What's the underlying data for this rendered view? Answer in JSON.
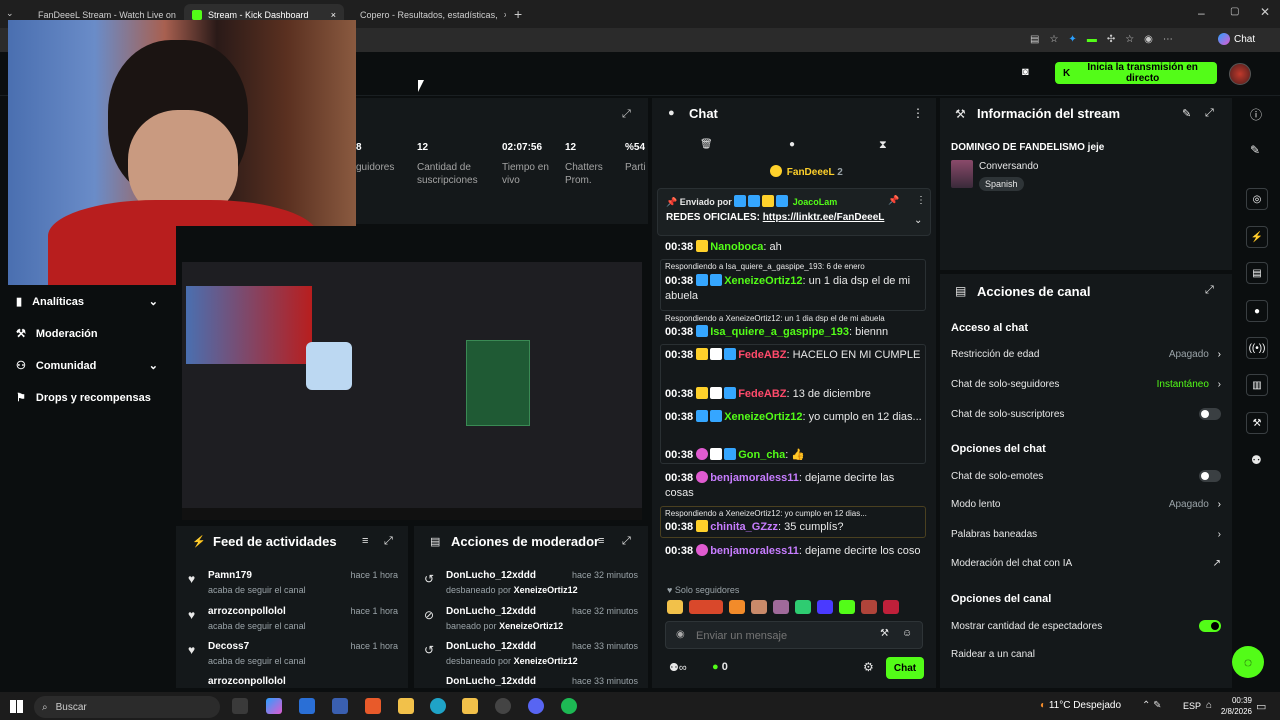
{
  "tabs": [
    {
      "label": "FanDeeeL Stream - Watch Live on"
    },
    {
      "label": "Stream - Kick Dashboard"
    },
    {
      "label": "Copero - Resultados, estadísticas,"
    }
  ],
  "browser": {
    "chat_label": "Chat"
  },
  "header": {
    "start_button": "Inicia la transmisión en directo"
  },
  "stats": [
    {
      "value": "8",
      "label": "guidores"
    },
    {
      "value": "12",
      "label": "Cantidad de suscripciones"
    },
    {
      "value": "02:07:56",
      "label": "Tiempo en vivo"
    },
    {
      "value": "12",
      "label": "Chatters Prom."
    },
    {
      "value": "%54",
      "label": "Parti"
    }
  ],
  "nav": {
    "analytics": "Analíticas",
    "moderation": "Moderación",
    "community": "Comunidad",
    "drops": "Drops y recompensas"
  },
  "feed": {
    "title": "Feed de actividades",
    "items": [
      {
        "user": "Pamn179",
        "action": "acaba de seguir el canal",
        "time": "hace 1 hora"
      },
      {
        "user": "arrozconpollolol",
        "action": "acaba de seguir el canal",
        "time": "hace 1 hora"
      },
      {
        "user": "Decoss7",
        "action": "acaba de seguir el canal",
        "time": "hace 1 hora"
      },
      {
        "user": "arrozconpollolol",
        "action": "",
        "time": ""
      }
    ]
  },
  "modactions": {
    "title": "Acciones de moderador",
    "items": [
      {
        "user": "DonLucho_12xddd",
        "action": "desbaneado por",
        "by": "XeneizeOrtiz12",
        "time": "hace 32 minutos"
      },
      {
        "user": "DonLucho_12xddd",
        "action": "baneado por",
        "by": "XeneizeOrtiz12",
        "time": "hace 32 minutos"
      },
      {
        "user": "DonLucho_12xddd",
        "action": "desbaneado por",
        "by": "XeneizeOrtiz12",
        "time": "hace 33 minutos"
      },
      {
        "user": "DonLucho_12xddd",
        "action": "",
        "by": "",
        "time": "hace 33 minutos"
      }
    ]
  },
  "chat": {
    "title": "Chat",
    "top_user": "FanDeeeL",
    "top_count": "2",
    "pinned_by_label": "Enviado por",
    "pinned_by_user": "JoacoLam",
    "pinned_text": "REDES OFICIALES: ",
    "pinned_link": "https://linktr.ee/FanDeeeL",
    "messages": [
      {
        "time": "00:38",
        "user": "Nanoboca",
        "user_color": "#53fc18",
        "text": ": ah",
        "reply": ""
      },
      {
        "time": "00:38",
        "user": "XeneizeOrtiz12",
        "user_color": "#53fc18",
        "text": ": un 1 dia dsp el de mi abuela",
        "reply": "Respondiendo a Isa_quiere_a_gaspipe_193: 6 de enero"
      },
      {
        "time": "00:38",
        "user": "Isa_quiere_a_gaspipe_193",
        "user_color": "#53fc18",
        "text": ": biennn",
        "reply": "Respondiendo a XeneizeOrtiz12: un 1 dia dsp el de mi abuela"
      },
      {
        "time": "00:38",
        "user": "FedeABZ",
        "user_color": "#ff4a6b",
        "text": ": HACELO EN MI CUMPLE",
        "reply": ""
      },
      {
        "time": "00:38",
        "user": "FedeABZ",
        "user_color": "#ff4a6b",
        "text": ": 13 de diciembre",
        "reply": ""
      },
      {
        "time": "00:38",
        "user": "XeneizeOrtiz12",
        "user_color": "#53fc18",
        "text": ": yo cumplo en 12 dias...",
        "reply": ""
      },
      {
        "time": "00:38",
        "user": "Gon_cha",
        "user_color": "#53fc18",
        "text": ":",
        "reply": ""
      },
      {
        "time": "00:38",
        "user": "benjamoraless11",
        "user_color": "#c77dff",
        "text": ": dejame decirte las cosas",
        "reply": ""
      },
      {
        "time": "00:38",
        "user": "chinita_GZzz",
        "user_color": "#c77dff",
        "text": ": 35 cumplís?",
        "reply": "Respondiendo a XeneizeOrtiz12: yo cumplo en 12 dias..."
      },
      {
        "time": "00:38",
        "user": "benjamoraless11",
        "user_color": "#c77dff",
        "text": ": dejame decirte los coso",
        "reply": ""
      }
    ],
    "followers_only": "Solo seguidores",
    "input_placeholder": "Enviar un mensaje",
    "viewer_count": "0",
    "send_label": "Chat"
  },
  "info": {
    "title": "Información del stream",
    "stream_title": "DOMINGO DE FANDELISMO jeje",
    "category": "Conversando",
    "language": "Spanish"
  },
  "actions": {
    "title": "Acciones de canal",
    "section_chat_access": "Acceso al chat",
    "age_restriction": "Restricción de edad",
    "age_value": "Apagado",
    "followers_only": "Chat de solo-seguidores",
    "followers_value": "Instantáneo",
    "subs_only": "Chat de solo-suscriptores",
    "section_chat_options": "Opciones del chat",
    "emotes_only": "Chat de solo-emotes",
    "slow_mode": "Modo lento",
    "slow_value": "Apagado",
    "banned_words": "Palabras baneadas",
    "ai_moderation": "Moderación del chat con IA",
    "section_channel_options": "Opciones del canal",
    "show_viewers": "Mostrar cantidad de espectadores",
    "raid": "Raidear a un canal"
  },
  "taskbar": {
    "search": "Buscar",
    "weather": "11°C  Despejado",
    "lang": "ESP",
    "time": "00:39",
    "date": "2/8/2026"
  },
  "colors": {
    "accent": "#53fc18",
    "panel": "#14181a",
    "bg": "#0b0e0f"
  }
}
